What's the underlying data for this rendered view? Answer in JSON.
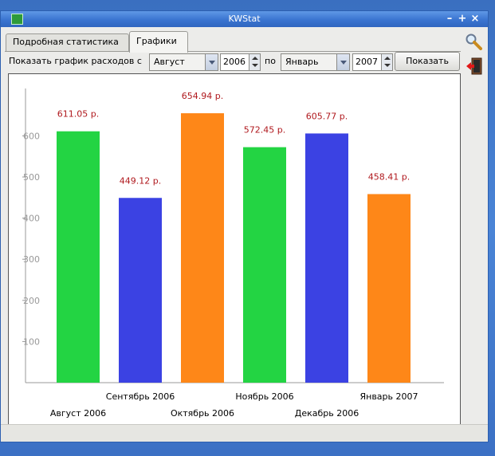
{
  "window": {
    "title": "KWStat"
  },
  "tabs": [
    {
      "label": "Подробная статистика",
      "active": false
    },
    {
      "label": "Графики",
      "active": true
    }
  ],
  "toolbar": {
    "show_label": "Показать график расходов с",
    "from_month": "Август",
    "from_year": "2006",
    "to_label": "по",
    "to_month": "Январь",
    "to_year": "2007",
    "show_button": "Показать"
  },
  "icons": {
    "settings": "wrench-magnifier-icon",
    "exit": "exit-door-icon"
  },
  "colors": {
    "green": "#23d443",
    "blue": "#3b42e3",
    "orange": "#fe8718",
    "value_label": "#b0191e"
  },
  "chart_data": {
    "type": "bar",
    "categories": [
      "Август 2006",
      "Сентябрь 2006",
      "Октябрь 2006",
      "Ноябрь 2006",
      "Декабрь 2006",
      "Январь 2007"
    ],
    "values": [
      611.05,
      449.12,
      654.94,
      572.45,
      605.77,
      458.41
    ],
    "value_labels": [
      "611.05 р.",
      "449.12 р.",
      "654.94 р.",
      "572.45 р.",
      "605.77 р.",
      "458.41 р."
    ],
    "bar_colors": [
      "#23d443",
      "#3b42e3",
      "#fe8718",
      "#23d443",
      "#3b42e3",
      "#fe8718"
    ],
    "yticks": [
      100,
      200,
      300,
      400,
      500,
      600
    ],
    "ylim": [
      0,
      700
    ],
    "grid": false,
    "legend": "none"
  }
}
